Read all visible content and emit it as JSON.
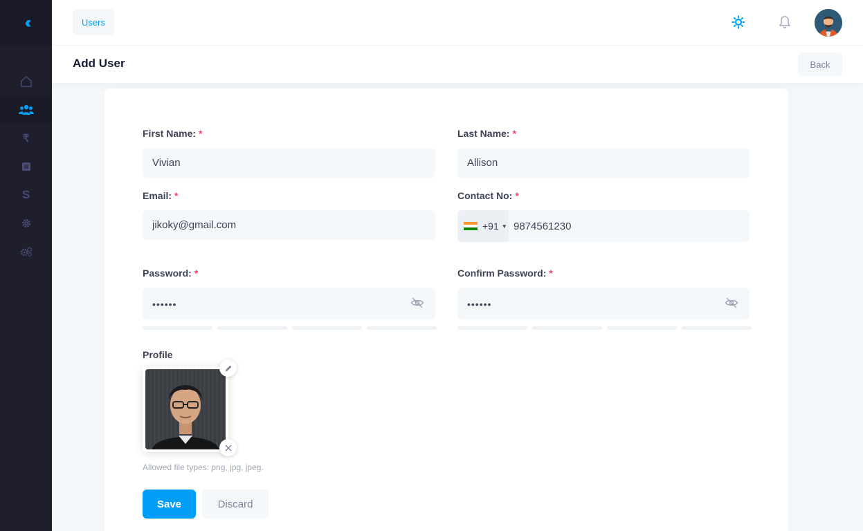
{
  "sidebar": {
    "items": [
      {
        "icon": "home-icon"
      },
      {
        "icon": "users-icon",
        "active": true
      },
      {
        "icon": "rupee-icon",
        "glyph": "₹"
      },
      {
        "icon": "square-icon"
      },
      {
        "icon": "dollar-icon",
        "glyph": "S"
      },
      {
        "icon": "gear-icon"
      },
      {
        "icon": "gears-icon"
      }
    ]
  },
  "header": {
    "breadcrumb": "Users",
    "accent": "#009ef7"
  },
  "toolbar": {
    "title": "Add User",
    "back_label": "Back"
  },
  "form": {
    "first_name": {
      "label": "First Name:",
      "required": "*",
      "value": "Vivian"
    },
    "last_name": {
      "label": "Last Name:",
      "required": "*",
      "value": "Allison"
    },
    "email": {
      "label": "Email:",
      "required": "*",
      "value": "jikoky@gmail.com"
    },
    "contact": {
      "label": "Contact No:",
      "required": "*",
      "dial_code": "+91",
      "value": "9874561230"
    },
    "password": {
      "label": "Password:",
      "required": "*",
      "value": "••••••"
    },
    "confirm_password": {
      "label": "Confirm Password:",
      "required": "*",
      "value": "••••••"
    },
    "profile": {
      "label": "Profile",
      "hint": "Allowed file types: png, jpg, jpeg."
    },
    "save_label": "Save",
    "discard_label": "Discard"
  }
}
